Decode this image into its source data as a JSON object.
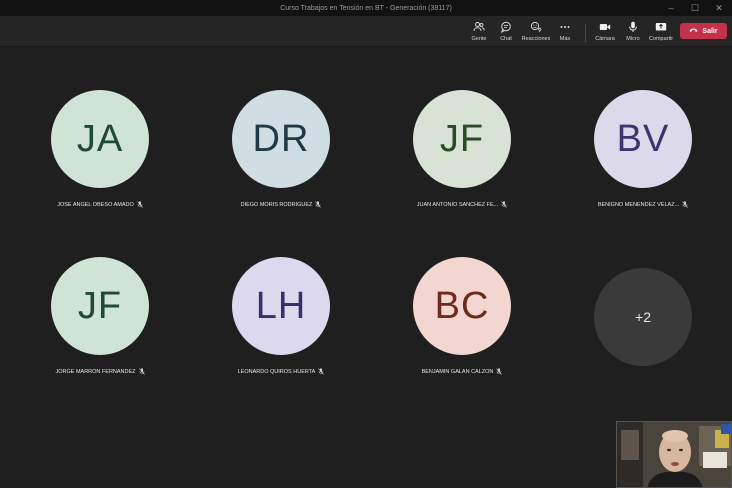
{
  "window": {
    "title": "Curso Trabajos en Tensión en BT - Generación (38117)",
    "controls": {
      "minimize": "–",
      "maximize": "☐",
      "close": "✕"
    }
  },
  "toolbar": {
    "people_label": "Gente",
    "chat_label": "Chat",
    "reactions_label": "Reacciones",
    "more_label": "Más",
    "camera_label": "Cámara",
    "mic_label": "Micro",
    "share_label": "Compartir",
    "leave_label": "Salir"
  },
  "participants": [
    {
      "initials": "JA",
      "name": "JOSE ANGEL OBESO AMADO",
      "bg": "#cfe3d6",
      "fg": "#1f4a33"
    },
    {
      "initials": "DR",
      "name": "DIEGO MORIS RODRIGUEZ",
      "bg": "#d0dde2",
      "fg": "#1f3a45"
    },
    {
      "initials": "JF",
      "name": "JUAN ANTONIO SANCHEZ FE...",
      "bg": "#d8e3d6",
      "fg": "#2b4a28"
    },
    {
      "initials": "BV",
      "name": "BENIGNO MENENDEZ VELAZ...",
      "bg": "#dcd9ea",
      "fg": "#3b3570"
    },
    {
      "initials": "JF",
      "name": "JORGE MARRON FERNANDEZ",
      "bg": "#cfe3d6",
      "fg": "#1f4a33"
    },
    {
      "initials": "LH",
      "name": "LEONARDO QUIROS HUERTA",
      "bg": "#dcd9ee",
      "fg": "#35306b"
    },
    {
      "initials": "BC",
      "name": "BENJAMIN GALAN CALZON",
      "bg": "#f2d6cf",
      "fg": "#6e2a1c"
    }
  ],
  "overflow": {
    "label": "+2"
  }
}
